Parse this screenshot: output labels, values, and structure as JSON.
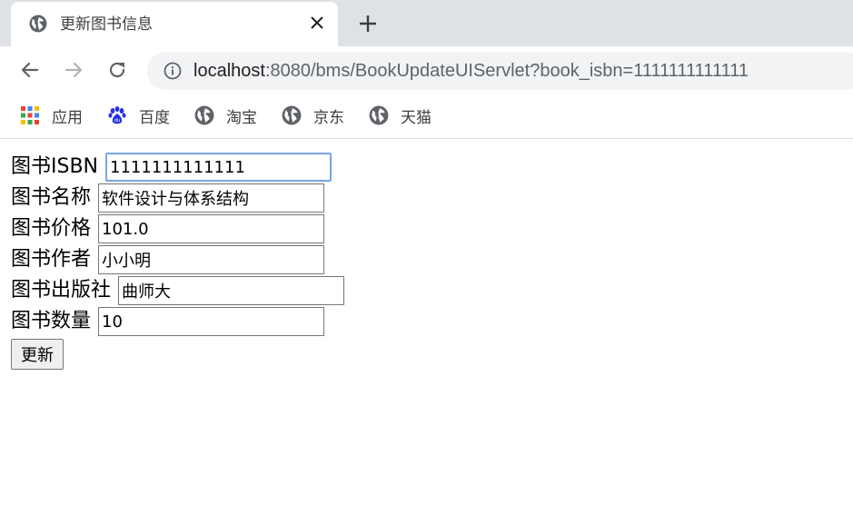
{
  "tab": {
    "title": "更新图书信息"
  },
  "address_bar": {
    "host": "localhost",
    "rest": ":8080/bms/BookUpdateUIServlet?book_isbn=1111111111111"
  },
  "bookmarks": [
    {
      "label": "应用",
      "icon": "apps-grid-icon"
    },
    {
      "label": "百度",
      "icon": "baidu-paw-icon"
    },
    {
      "label": "淘宝",
      "icon": "globe-icon"
    },
    {
      "label": "京东",
      "icon": "globe-icon"
    },
    {
      "label": "天猫",
      "icon": "globe-icon"
    }
  ],
  "form": {
    "fields": [
      {
        "label": "图书ISBN",
        "value": "1111111111111"
      },
      {
        "label": "图书名称",
        "value": "软件设计与体系结构"
      },
      {
        "label": "图书价格",
        "value": "101.0"
      },
      {
        "label": "图书作者",
        "value": "小小明"
      },
      {
        "label": "图书出版社",
        "value": "曲师大"
      },
      {
        "label": "图书数量",
        "value": "10"
      }
    ],
    "submit_label": "更新"
  }
}
